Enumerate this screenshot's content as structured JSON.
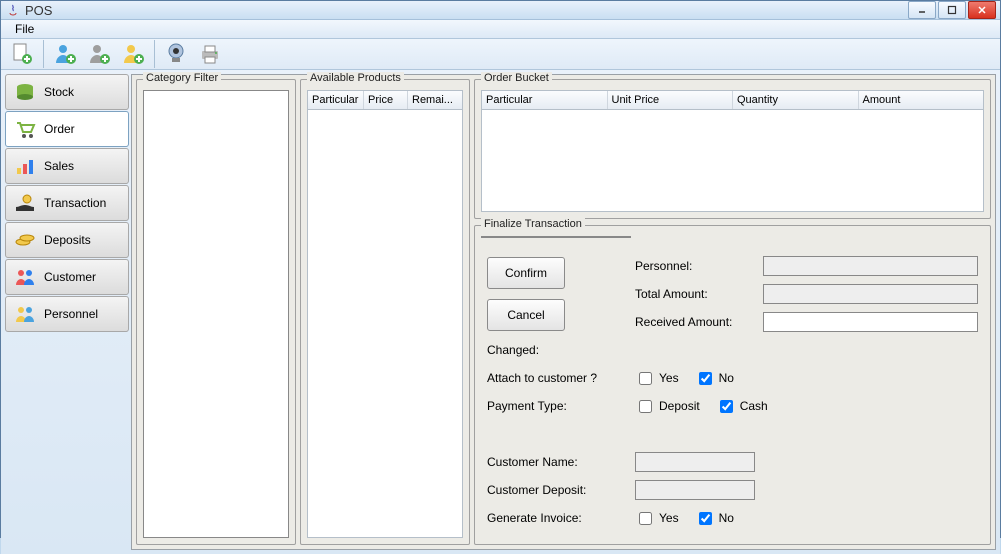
{
  "window": {
    "title": "POS"
  },
  "menubar": {
    "file": "File"
  },
  "nav": {
    "items": [
      {
        "label": "Stock"
      },
      {
        "label": "Order"
      },
      {
        "label": "Sales"
      },
      {
        "label": "Transaction"
      },
      {
        "label": "Deposits"
      },
      {
        "label": "Customer"
      },
      {
        "label": "Personnel"
      }
    ]
  },
  "panels": {
    "category_filter": "Category Filter",
    "available_products": "Available Products",
    "order_bucket": "Order Bucket",
    "finalize": "Finalize Transaction"
  },
  "available_cols": {
    "particular": "Particular",
    "price": "Price",
    "remaining": "Remai..."
  },
  "bucket_cols": {
    "particular": "Particular",
    "unit_price": "Unit Price",
    "quantity": "Quantity",
    "amount": "Amount"
  },
  "finalize_form": {
    "personnel": "Personnel:",
    "total_amount": "Total Amount:",
    "received_amount": "Received Amount:",
    "changed": "Changed:",
    "attach_customer": "Attach to customer ?",
    "payment_type": "Payment Type:",
    "customer_name": "Customer Name:",
    "customer_deposit": "Customer Deposit:",
    "generate_invoice": "Generate Invoice:"
  },
  "options": {
    "yes": "Yes",
    "no": "No",
    "deposit": "Deposit",
    "cash": "Cash"
  },
  "buttons": {
    "confirm": "Confirm",
    "cancel": "Cancel"
  }
}
